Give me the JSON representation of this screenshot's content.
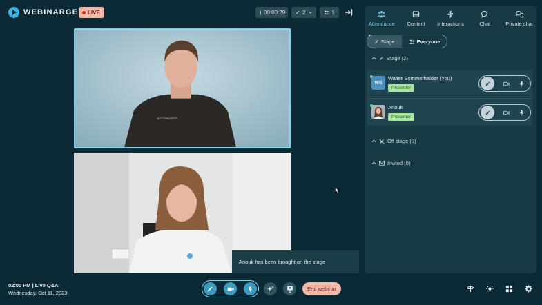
{
  "header": {
    "brand": "WEBINARGEEK",
    "live_label": "LIVE",
    "recording_time": "00:00:29",
    "stage_count": "2",
    "attendee_count": "1"
  },
  "stage_videos": [
    {
      "name": "Walter Sommerhalder"
    },
    {
      "name": "Anouk"
    }
  ],
  "toast": {
    "message": "Anouk has been brought on the stage"
  },
  "panel": {
    "tabs": [
      {
        "label": "Attendance",
        "icon": "people-icon",
        "active": true
      },
      {
        "label": "Content",
        "icon": "image-icon",
        "active": false
      },
      {
        "label": "Interactions",
        "icon": "lightning-icon",
        "active": false
      },
      {
        "label": "Chat",
        "icon": "chat-bubble-icon",
        "active": false
      },
      {
        "label": "Private chat",
        "icon": "chat-bubbles-icon",
        "active": false
      }
    ],
    "filter": {
      "stage_label": "Stage",
      "everyone_label": "Everyone"
    },
    "sections": {
      "stage": "Stage (2)",
      "off_stage": "Off stage (0)",
      "invited": "Invited (0)"
    },
    "participants": [
      {
        "initials": "WS",
        "name": "Walter Sommerhalder",
        "suffix": "(You)",
        "role": "Presenter"
      },
      {
        "initials": "",
        "name": "Anouk",
        "suffix": "",
        "role": "Presenter"
      }
    ]
  },
  "footer": {
    "time_line": "02:00 PM | Live Q&A",
    "date_line": "Wednesday, Oct 11, 2023",
    "end_label": "End webinar"
  },
  "colors": {
    "background": "#0b2a35",
    "panel": "#183a45",
    "accent": "#7fd3ee",
    "live_badge": "#f2b8a9",
    "presenter_badge": "#a8e6a2"
  }
}
